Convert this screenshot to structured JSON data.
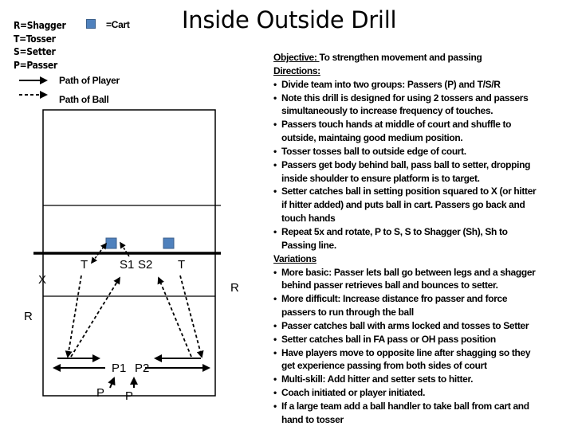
{
  "title": "Inside Outside Drill",
  "legend": {
    "keys": [
      "R=Shagger",
      "T=Tosser",
      "S=Setter",
      "P=Passer"
    ],
    "cart_label": "=Cart",
    "cart_icon": "blue-square",
    "player_path_label": "Path of Player",
    "ball_path_label": "Path of Ball",
    "cart_color": "#4f81bd"
  },
  "court": {
    "labels": {
      "tosser_left": "T",
      "tosser_right": "T",
      "setter_1": "S1",
      "setter_2": "S2",
      "target": "X",
      "shagger_left": "R",
      "shagger_right": "R",
      "passer_1": "P1",
      "passer_2": "P2",
      "passer_line_left": "P",
      "passer_line_right": "P"
    }
  },
  "instructions": {
    "objective_label": "Objective: ",
    "objective_text": " To strengthen movement and passing",
    "directions_label": "Directions:",
    "directions": [
      [
        "Divide team into two groups: Passers (P) and T/S/R"
      ],
      [
        "Note this drill is designed for using 2 tossers and passers",
        "simultaneously to increase frequency of touches."
      ],
      [
        "Passers touch hands at middle of court and shuffle to",
        "outside, maintaing good medium position."
      ],
      [
        "Tosser  tosses ball to outside edge of court."
      ],
      [
        "Passers  get body behind ball, pass ball  to setter, dropping",
        "inside shoulder to ensure platform is to target."
      ],
      [
        "Setter catches ball in  setting  position squared to X (or hitter",
        "if hitter added) and puts ball in cart. Passers go back and",
        "touch hands"
      ],
      [
        "Repeat 5x  and rotate, P to S,  S to Shagger (Sh), Sh to",
        "Passing line."
      ]
    ],
    "variations_label": "Variations",
    "variations": [
      [
        "More basic: Passer lets ball go between legs and a shagger",
        "behind passer retrieves ball and bounces to setter."
      ],
      [
        "More difficult:  Increase distance fro passer and force",
        "passers to run through the ball"
      ],
      [
        "Passer catches ball with arms locked and tosses to Setter"
      ],
      [
        "Setter catches ball in FA pass or OH pass position"
      ],
      [
        "Have players move to opposite line after shagging so they",
        "get experience passing from both sides of court"
      ],
      [
        "Multi-skill:  Add hitter and setter sets to hitter."
      ],
      [
        "Coach initiated or player initiated."
      ],
      [
        " If a large team add a ball handler to take ball from cart and",
        "hand to tosser"
      ]
    ]
  }
}
